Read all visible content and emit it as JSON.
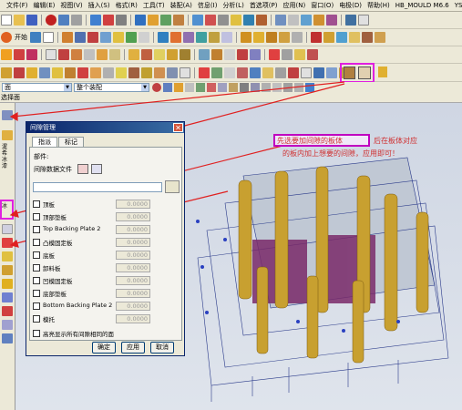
{
  "menubar": {
    "items": [
      "文件(F)",
      "编辑(E)",
      "视图(V)",
      "插入(S)",
      "格式(R)",
      "工具(T)",
      "装配(A)",
      "信息(I)",
      "分析(L)",
      "首选项(P)",
      "应用(N)",
      "窗口(O)",
      "电极(D)",
      "帮助(H)",
      "HB_MOULD M6.6",
      "YSUG"
    ]
  },
  "toolbar2": {
    "start_label": "开始"
  },
  "selection_bar": {
    "filter_value": "面",
    "scope_value": "整个装配"
  },
  "subheader": {
    "label": "选择面"
  },
  "left_rail": {
    "text1": "渥希冰漆",
    "text2": "冰"
  },
  "dialog": {
    "title": "间隙管理",
    "tabs": [
      "指派",
      "标记"
    ],
    "parts_label": "部件:",
    "data_file_label": "间隙数据文件",
    "path_value": "",
    "plates": [
      {
        "name": "顶板",
        "value": "0.0000"
      },
      {
        "name": "顶部垫板",
        "value": "0.0000"
      },
      {
        "name": "Top Backing Plate 2",
        "value": "0.0000"
      },
      {
        "name": "凸模固定板",
        "value": "0.0000"
      },
      {
        "name": "底板",
        "value": "0.0000"
      },
      {
        "name": "卸料板",
        "value": "0.0000"
      },
      {
        "name": "凹模固定板",
        "value": "0.0000"
      },
      {
        "name": "底部垫板",
        "value": "0.0000"
      },
      {
        "name": "Bottom Backing Plate 2",
        "value": "0.0000"
      },
      {
        "name": "模托",
        "value": "0.0000"
      }
    ],
    "highlight_checkbox": "高亮显示所有间隙相同的面",
    "ok_label": "确定",
    "apply_label": "应用",
    "cancel_label": "取消"
  },
  "annotation": {
    "box_text": "先选要加间隙的板体",
    "line1_rest": "后在板体对应",
    "line2": "的板内加上想要的间隙，应用即可！"
  }
}
